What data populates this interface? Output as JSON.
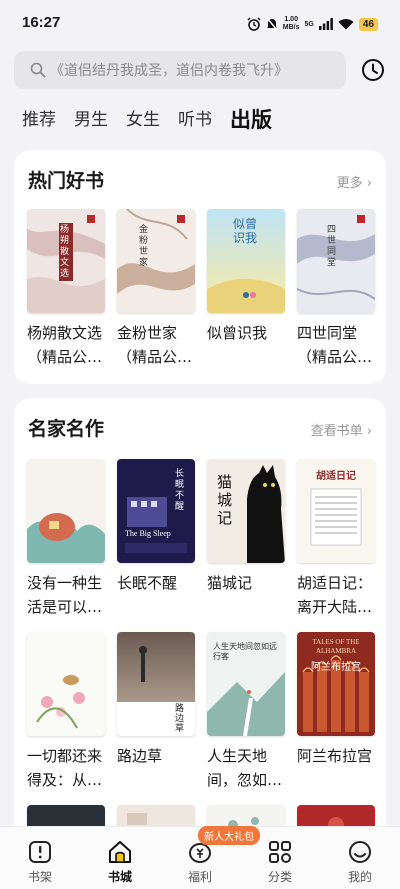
{
  "status": {
    "time": "16:27",
    "speed_value": "1.00",
    "speed_unit": "MB/s",
    "network": "5G",
    "battery": "46"
  },
  "search": {
    "placeholder": "《道侣结丹我成圣，道侣内卷我飞升》"
  },
  "tabs": [
    {
      "label": "推荐"
    },
    {
      "label": "男生"
    },
    {
      "label": "女生"
    },
    {
      "label": "听书"
    },
    {
      "label": "出版",
      "active": true
    }
  ],
  "hot_books": {
    "title": "热门好书",
    "more": "更多",
    "books": [
      {
        "name": "杨朔散文选（精品公版）",
        "cover_text": "杨朔散文选",
        "cover_style": "marble-red"
      },
      {
        "name": "金粉世家（精品公版）",
        "cover_text": "金粉世家",
        "cover_style": "marble-brown"
      },
      {
        "name": "似曾识我",
        "cover_text": "似曾识我",
        "cover_style": "sky"
      },
      {
        "name": "四世同堂（精品公版）",
        "cover_text": "四世同堂",
        "cover_style": "marble-blue"
      }
    ]
  },
  "famous": {
    "title": "名家名作",
    "more": "查看书单",
    "books": [
      {
        "name": "没有一种生活是可以被辜负的",
        "cover_style": "garden"
      },
      {
        "name": "长眠不醒",
        "cover_text": "长眠不醒",
        "cover_text_en": "The Big Sleep",
        "cover_style": "night"
      },
      {
        "name": "猫城记",
        "cover_text": "猫城记",
        "cover_style": "cat"
      },
      {
        "name": "胡适日记：离开大陆以后",
        "cover_text": "胡适日记",
        "cover_style": "diary"
      },
      {
        "name": "一切都还来得及：从未来看现在",
        "cover_style": "flowers"
      },
      {
        "name": "路边草",
        "cover_text": "路边草",
        "cover_style": "dusk"
      },
      {
        "name": "人生天地间，忽如远行客",
        "cover_text": "人生天地间忽如远行客",
        "cover_style": "road"
      },
      {
        "name": "阿兰布拉宫",
        "cover_text": "阿兰布拉宫",
        "cover_text_en": "TALES OF THE ALHAMBRA",
        "cover_style": "palace"
      }
    ]
  },
  "bottom_nav": [
    {
      "label": "书架",
      "icon": "bookshelf-icon"
    },
    {
      "label": "书城",
      "icon": "home-icon",
      "active": true
    },
    {
      "label": "福利",
      "icon": "welfare-icon"
    },
    {
      "label": "分类",
      "icon": "category-icon"
    },
    {
      "label": "我的",
      "icon": "profile-icon"
    }
  ],
  "promo_badge": "新人大礼包",
  "colors": {
    "accent": "#f5c518",
    "badge": "#f0773a",
    "background": "#f3f3f5"
  }
}
